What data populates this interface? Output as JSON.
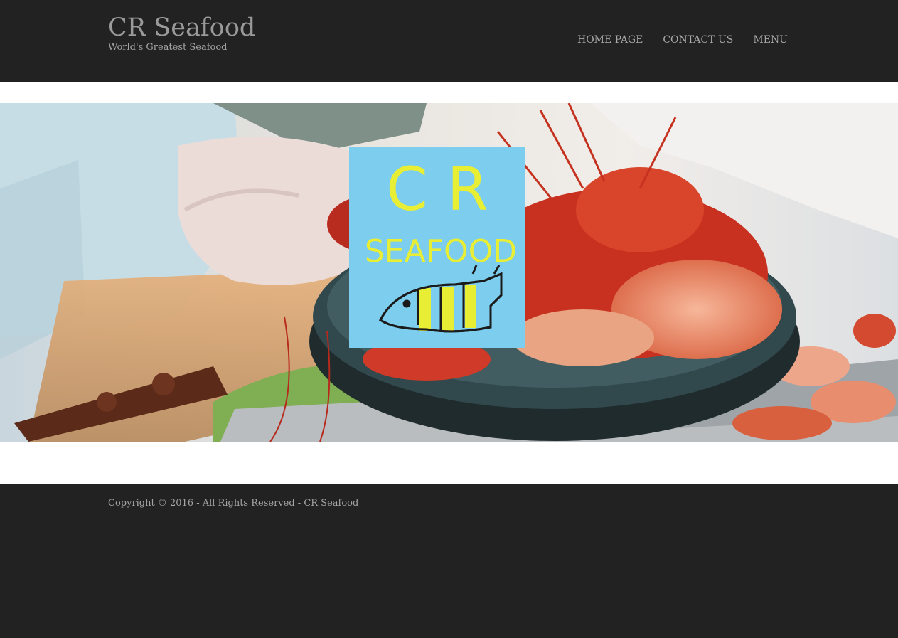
{
  "header": {
    "site_title": "CR Seafood",
    "tagline": "World's Greatest Seafood",
    "nav": [
      {
        "label": "HOME PAGE"
      },
      {
        "label": "CONTACT US"
      },
      {
        "label": "MENU"
      }
    ]
  },
  "hero": {
    "logo": {
      "line1": "C R",
      "line2": "SEAFOOD",
      "background_color": "#7ccdee",
      "text_color": "#e8ee34"
    }
  },
  "footer": {
    "copyright": "Copyright © 2016 - All Rights Reserved - CR Seafood"
  },
  "colors": {
    "bar_background": "#222222",
    "header_text": "#9a9a9a"
  }
}
